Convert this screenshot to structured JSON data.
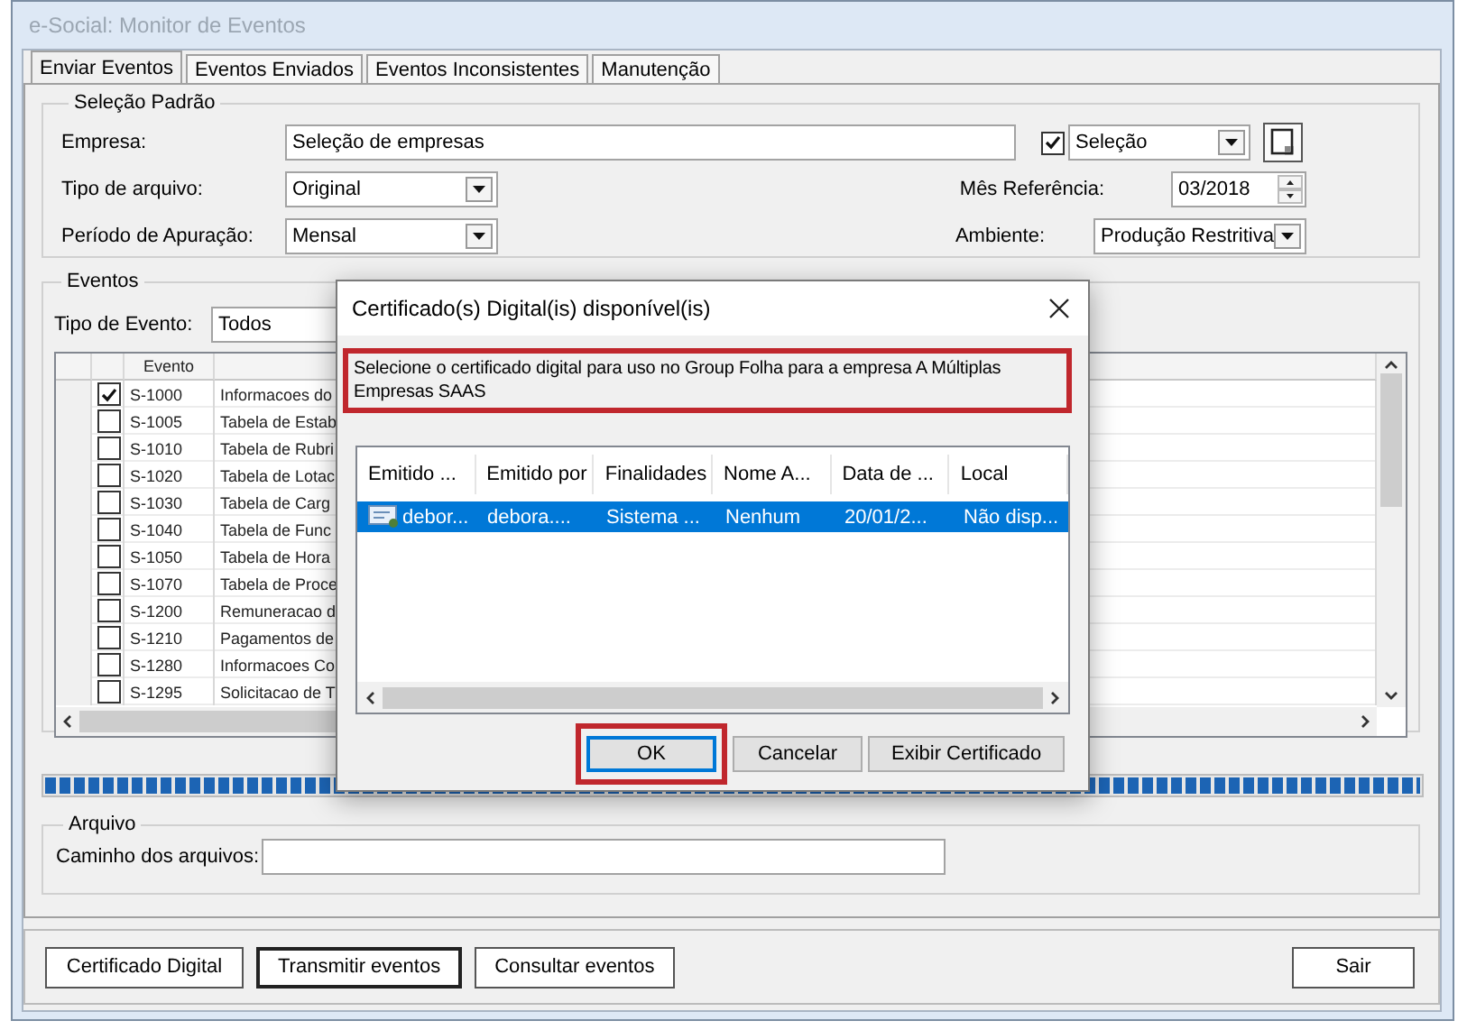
{
  "window": {
    "title": "e-Social: Monitor de Eventos"
  },
  "tabs": [
    {
      "label": "Enviar Eventos",
      "selected": true
    },
    {
      "label": "Eventos Enviados",
      "selected": false
    },
    {
      "label": "Eventos Inconsistentes",
      "selected": false
    },
    {
      "label": "Manutenção",
      "selected": false
    }
  ],
  "selecao_padrao": {
    "title": "Seleção Padrão",
    "empresa": {
      "label": "Empresa:",
      "value": "Seleção de empresas"
    },
    "selecao": {
      "checked": true,
      "value": "Seleção"
    },
    "tipo_arquivo": {
      "label": "Tipo de arquivo:",
      "value": "Original"
    },
    "mes_referencia": {
      "label": "Mês Referência:",
      "value": "03/2018"
    },
    "periodo": {
      "label": "Período de Apuração:",
      "value": "Mensal"
    },
    "ambiente": {
      "label": "Ambiente:",
      "value": "Produção Restritiva"
    }
  },
  "eventos": {
    "title": "Eventos",
    "tipo_evento": {
      "label": "Tipo de Evento:",
      "value": "Todos"
    },
    "column": "Evento",
    "rows": [
      {
        "checked": true,
        "code": "S-1000",
        "description": "Informacoes do"
      },
      {
        "checked": false,
        "code": "S-1005",
        "description": "Tabela de Estab"
      },
      {
        "checked": false,
        "code": "S-1010",
        "description": "Tabela de Rubri"
      },
      {
        "checked": false,
        "code": "S-1020",
        "description": "Tabela de Lotac"
      },
      {
        "checked": false,
        "code": "S-1030",
        "description": "Tabela de Carg"
      },
      {
        "checked": false,
        "code": "S-1040",
        "description": "Tabela de Func"
      },
      {
        "checked": false,
        "code": "S-1050",
        "description": "Tabela de Hora"
      },
      {
        "checked": false,
        "code": "S-1070",
        "description": "Tabela de Proce"
      },
      {
        "checked": false,
        "code": "S-1200",
        "description": "Remuneracao d"
      },
      {
        "checked": false,
        "code": "S-1210",
        "description": "Pagamentos de"
      },
      {
        "checked": false,
        "code": "S-1280",
        "description": "Informacoes Co"
      },
      {
        "checked": false,
        "code": "S-1295",
        "description": "Solicitacao de T"
      }
    ]
  },
  "progress": {
    "level": 1
  },
  "arquivo": {
    "title": "Arquivo",
    "caminho": {
      "label": "Caminho dos arquivos:"
    }
  },
  "buttons": [
    {
      "label": "Certificado Digital",
      "default": false
    },
    {
      "label": "Transmitir eventos",
      "default": true
    },
    {
      "label": "Consultar eventos",
      "default": false
    }
  ],
  "exit_button": {
    "label": "Sair"
  },
  "dialog": {
    "title": "Certificado(s) Digital(is) disponível(is)",
    "message": {
      "text": "Selecione o certificado digital para uso no Group Folha para a empresa A Múltiplas Empresas SAAS",
      "highlighted": true
    },
    "columns": [
      "Emitido ...",
      "Emitido por",
      "Finalidades",
      "Nome A...",
      "Data de ...",
      "Local"
    ],
    "rows": [
      {
        "selected": true,
        "cells": [
          "debor...",
          "debora....",
          "Sistema ...",
          "Nenhum",
          "20/01/2...",
          "Não disp..."
        ]
      }
    ],
    "buttons": [
      {
        "label": "OK",
        "highlighted": true
      },
      {
        "label": "Cancelar",
        "highlighted": false
      },
      {
        "label": "Exibir Certificado",
        "highlighted": false
      }
    ]
  }
}
